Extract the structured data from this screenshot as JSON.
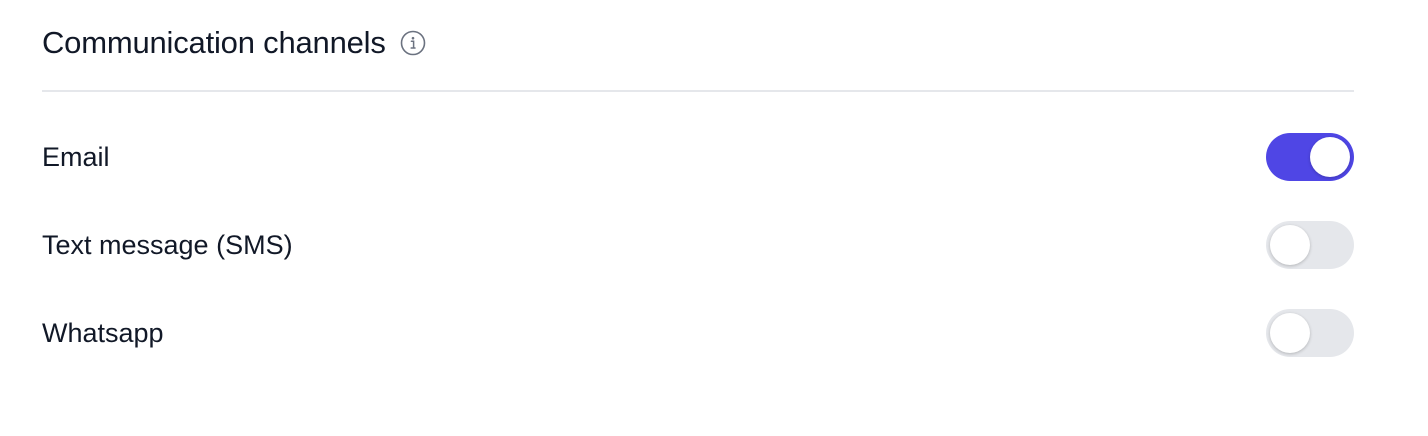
{
  "section": {
    "title": "Communication channels",
    "info_icon": "info-circle-icon"
  },
  "channels": [
    {
      "label": "Email",
      "enabled": true
    },
    {
      "label": "Text message (SMS)",
      "enabled": false
    },
    {
      "label": "Whatsapp",
      "enabled": false
    }
  ],
  "colors": {
    "toggle_on": "#4f46e5",
    "toggle_off": "#e5e7eb",
    "divider": "#e5e7eb",
    "text": "#111827",
    "icon": "#6b7280"
  }
}
